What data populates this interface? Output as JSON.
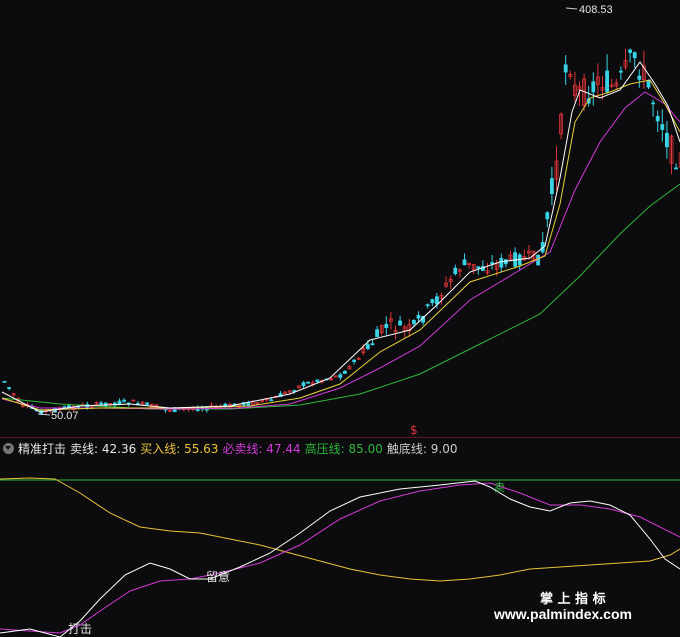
{
  "main": {
    "price_high_label": "408.53",
    "price_low_label": "50.07",
    "signal_glyph": "$",
    "colors": {
      "up": "#e0343a",
      "down": "#38d4e6",
      "ma_fast": "#ffffff",
      "ma_mid": "#e8d23a",
      "ma_slow": "#d23ad8",
      "ma_long": "#2fb83a"
    }
  },
  "indicator": {
    "name": "精准打击",
    "items": [
      {
        "label": "卖线: 42.36",
        "color": "#e6e6e6"
      },
      {
        "label": "买入线: 55.63",
        "color": "#e8c33a"
      },
      {
        "label": "必卖线: 47.44",
        "color": "#d23ad8"
      },
      {
        "label": "高压线: 85.00",
        "color": "#2fb83a"
      },
      {
        "label": "触底线: 9.00",
        "color": "#cccccc"
      }
    ]
  },
  "sub": {
    "label_strike": "打击",
    "label_watch": "留意",
    "label_sell": "卖",
    "watermark_title": "掌 上 指 标",
    "watermark_url": "www.palmindex.com"
  }
}
